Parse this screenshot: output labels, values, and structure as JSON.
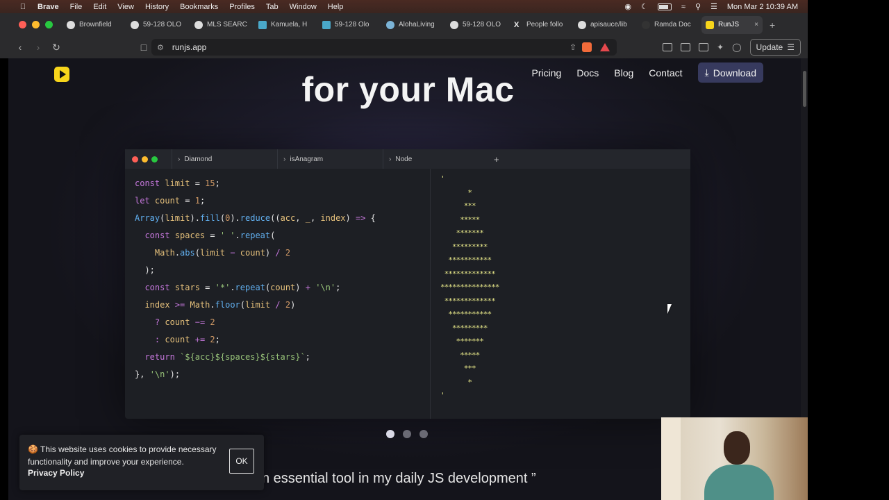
{
  "menubar": {
    "app": "Brave",
    "menus": [
      "File",
      "Edit",
      "View",
      "History",
      "Bookmarks",
      "Profiles",
      "Tab",
      "Window",
      "Help"
    ],
    "clock": "Mon Mar 2  10:39 AM"
  },
  "tabs": [
    {
      "label": "Brownfield",
      "icon": "brownfield-favicon"
    },
    {
      "label": "59-128 OLO",
      "icon": "globe-favicon"
    },
    {
      "label": "MLS SEARC",
      "icon": "globe-favicon"
    },
    {
      "label": "Kamuela, H",
      "icon": "house-favicon"
    },
    {
      "label": "59-128 Olo",
      "icon": "house-favicon"
    },
    {
      "label": "AlohaLiving",
      "icon": "aloha-favicon"
    },
    {
      "label": "59-128 OLO",
      "icon": "globe-favicon"
    },
    {
      "label": "People follo",
      "icon": "x-favicon"
    },
    {
      "label": "apisauce/lib",
      "icon": "github-favicon"
    },
    {
      "label": "Ramda Doc",
      "icon": "ramda-favicon"
    }
  ],
  "active_tab": {
    "label": "RunJS",
    "close": "×"
  },
  "new_tab": "+",
  "address": {
    "url": "runjs.app"
  },
  "update_label": "Update",
  "site": {
    "nav": [
      "Pricing",
      "Docs",
      "Blog",
      "Contact"
    ],
    "download_label": "Download",
    "hero_title": "for your Mac",
    "quote": "n essential tool in my daily JS development ”"
  },
  "app_window": {
    "tabs": [
      "Diamond",
      "isAnagram",
      "Node"
    ],
    "add_tab": "+"
  },
  "output_lines": [
    "'",
    "       *",
    "      ***",
    "     *****",
    "    *******",
    "   *********",
    "  ***********",
    " *************",
    "***************",
    " *************",
    "  ***********",
    "   *********",
    "    *******",
    "     *****",
    "      ***",
    "       *",
    "'"
  ],
  "carousel": {
    "count": 3,
    "active": 0
  },
  "cookie": {
    "message": "🍪 This website uses cookies to provide necessary functionality and improve your experience.",
    "policy": "Privacy Policy",
    "ok": "OK"
  },
  "colors": {
    "brand_yellow": "#f7d51b",
    "download_bg": "#373a5e",
    "code_keyword": "#c678dd",
    "code_output": "#e8e88a"
  }
}
